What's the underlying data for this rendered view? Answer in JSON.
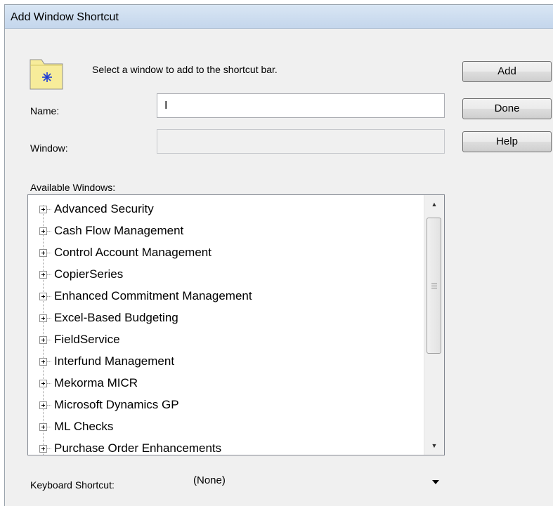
{
  "dialog": {
    "title": "Add Window Shortcut",
    "instruction": "Select a window to add to the shortcut bar."
  },
  "form": {
    "name_label": "Name:",
    "name_value": "I",
    "window_label": "Window:",
    "window_value": "",
    "available_label": "Available Windows:",
    "keyboard_label": "Keyboard Shortcut:",
    "keyboard_value": "(None)"
  },
  "buttons": {
    "add": "Add",
    "done": "Done",
    "help": "Help"
  },
  "tree_items": [
    "Advanced Security",
    "Cash Flow Management",
    "Control Account Management",
    "CopierSeries",
    "Enhanced Commitment Management",
    "Excel-Based Budgeting",
    "FieldService",
    "Interfund Management",
    "Mekorma MICR",
    "Microsoft Dynamics GP",
    "ML Checks",
    "Purchase Order Enhancements"
  ],
  "icons": {
    "folder": "folder-icon",
    "expand": "plus-box-icon",
    "scroll_up": "up-arrow-icon",
    "scroll_down": "down-arrow-icon",
    "dropdown": "chevron-down-icon"
  },
  "colors": {
    "titlebar": "#c9d9ec",
    "dialog_bg": "#f0f0f0",
    "folder_fill": "#f7ec9a",
    "folder_star": "#1c3bd6"
  }
}
